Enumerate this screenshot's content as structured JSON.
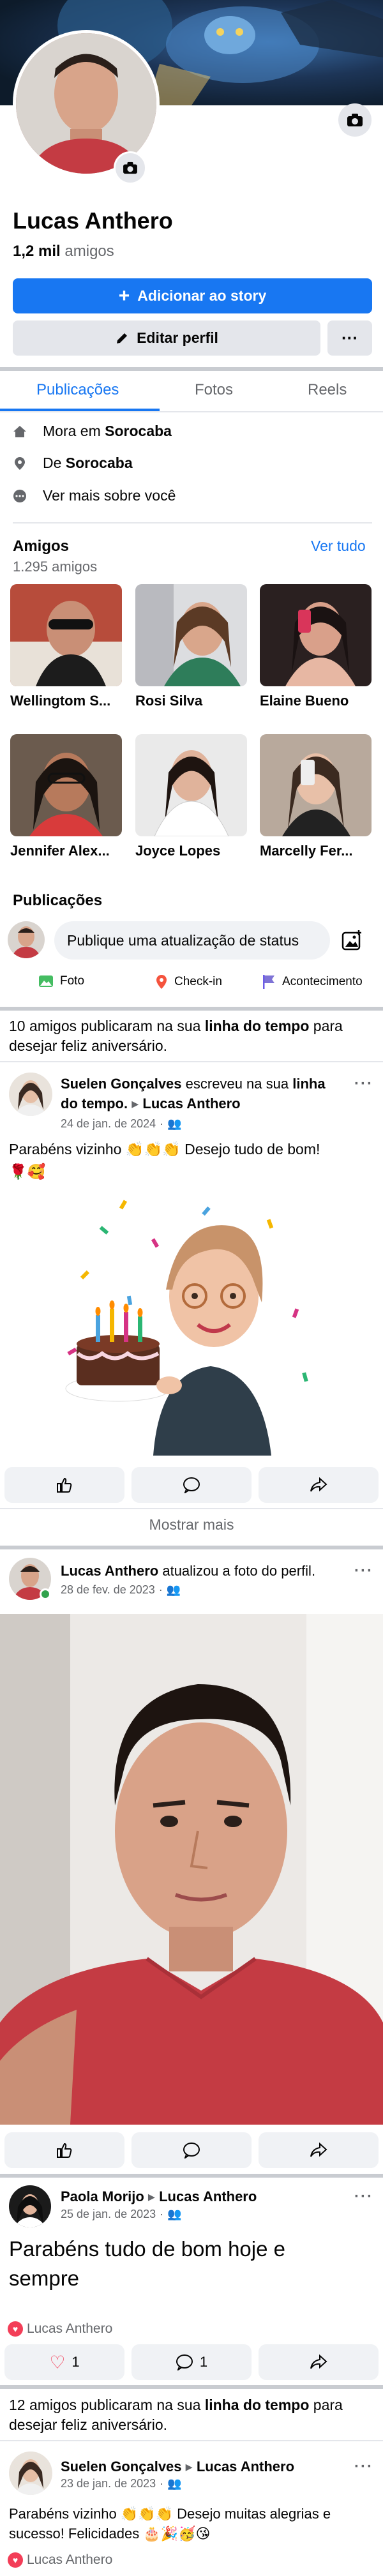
{
  "profile": {
    "name": "Lucas Anthero",
    "friends_count": "1,2 mil",
    "friends_label": "amigos",
    "add_story_label": "Adicionar ao story",
    "edit_profile_label": "Editar perfil",
    "more_label": "···"
  },
  "tabs": [
    {
      "label": "Publicações",
      "active": true
    },
    {
      "label": "Fotos",
      "active": false
    },
    {
      "label": "Reels",
      "active": false
    }
  ],
  "about": {
    "lives_prefix": "Mora em",
    "lives_city": "Sorocaba",
    "from_prefix": "De",
    "from_city": "Sorocaba",
    "see_more": "Ver mais sobre você"
  },
  "friends": {
    "title": "Amigos",
    "see_all": "Ver tudo",
    "count": "1.295 amigos",
    "items": [
      {
        "name": "Wellingtom S..."
      },
      {
        "name": "Rosi Silva"
      },
      {
        "name": "Elaine Bueno"
      },
      {
        "name": "Jennifer Alex..."
      },
      {
        "name": "Joyce Lopes"
      },
      {
        "name": "Marcelly Fer..."
      }
    ]
  },
  "posts_section": {
    "title": "Publicações",
    "status_placeholder": "Publique uma atualização de status",
    "quick_actions": [
      "Foto",
      "Check-in",
      "Acontecimento"
    ]
  },
  "birthday_group_1": {
    "prefix": "10 amigos publicaram na sua",
    "link": "linha do tempo",
    "suffix": "para desejar feliz aniversário."
  },
  "post1": {
    "author": "Suelen Gonçalves",
    "verb": "escreveu na sua",
    "link": "linha do tempo.",
    "target": "Lucas Anthero",
    "date": "24 de jan. de 2024",
    "text": "Parabéns vizinho 👏👏👏 Desejo tudo de bom!",
    "emojis": "🌹🥰"
  },
  "show_more": "Mostrar mais",
  "post2": {
    "author": "Lucas Anthero",
    "verb": "atualizou a foto do perfil.",
    "date": "28 de fev. de 2023"
  },
  "post3": {
    "author": "Paola Morijo",
    "target": "Lucas Anthero",
    "date": "25 de jan. de 2023",
    "text": "Parabéns tudo de bom hoje e sempre",
    "liked_by": "Lucas Anthero",
    "likes": "1",
    "comments": "1"
  },
  "birthday_group_2": {
    "prefix": "12 amigos publicaram na sua",
    "link": "linha do tempo",
    "suffix": "para desejar feliz aniversário."
  },
  "post4": {
    "author": "Suelen Gonçalves",
    "target": "Lucas Anthero",
    "date": "23 de jan. de 2023",
    "text": "Parabéns vizinho 👏👏👏 Desejo muitas alegrias e sucesso! Felicidades 🎂🎉🥳😘",
    "liked_by": "Lucas Anthero"
  },
  "colors": {
    "accent": "#1877f2",
    "separator": "#c9ccd1",
    "muted": "#65676b",
    "button_grey": "#e4e6eb",
    "heart": "#f33e58"
  }
}
